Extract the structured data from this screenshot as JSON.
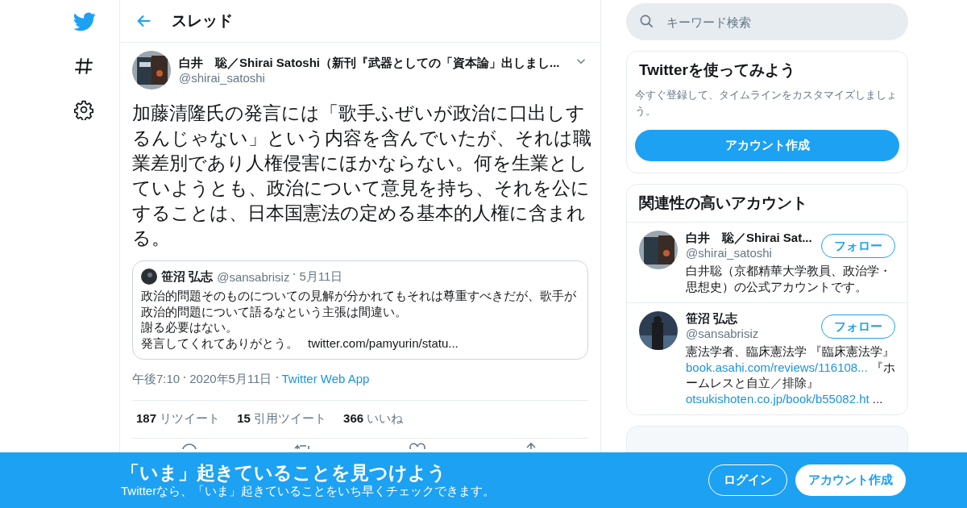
{
  "header": {
    "title": "スレッド"
  },
  "tweet": {
    "name": "白井　聡／Shirai Satoshi（新刊『武器としての「資本論」出しまし...",
    "handle": "@shirai_satoshi",
    "text": "加藤清隆氏の発言には「歌手ふぜいが政治に口出しするんじゃない」という内容を含んでいたが、それは職業差別であり人権侵害にほかならない。何を生業としていようとも、政治について意見を持ち、それを公にすることは、日本国憲法の定める基本的人権に含まれる。",
    "quote": {
      "name": "笹沼 弘志",
      "handle": "@sansabrisiz",
      "date": "5月11日",
      "lines": [
        "政治的問題そのものについての見解が分かれてもそれは尊重すべきだが、歌手が政治的問題について語るなという主張は間違い。",
        "謝る必要はない。"
      ],
      "last_line": "発言してくれてありがとう。",
      "link": "twitter.com/pamyurin/statu..."
    },
    "time": "午後7:10",
    "date": "2020年5月11日",
    "source": "Twitter Web App",
    "stats": [
      {
        "count": "187",
        "label": "リツイート"
      },
      {
        "count": "15",
        "label": "引用ツイート"
      },
      {
        "count": "366",
        "label": "いいね"
      }
    ]
  },
  "search": {
    "placeholder": "キーワード検索"
  },
  "signup": {
    "title": "Twitterを使ってみよう",
    "text": "今すぐ登録して、タイムラインをカスタマイズしましょう。",
    "button": "アカウント作成"
  },
  "related": {
    "title": "関連性の高いアカウント",
    "accounts": [
      {
        "name": "白井　聡／Shirai Sat...",
        "handle": "@shirai_satoshi",
        "follow": "フォロー",
        "bio": [
          {
            "kind": "text",
            "text": "白井聡（京都精華大学教員、政治学・思想史）の公式アカウントです。"
          }
        ]
      },
      {
        "name": "笹沼 弘志",
        "handle": "@sansabrisiz",
        "follow": "フォロー",
        "bio": [
          {
            "kind": "text",
            "text": "憲法学者、臨床憲法学 『臨床憲法学』"
          },
          {
            "kind": "link",
            "text": "book.asahi.com/reviews/116108..."
          },
          {
            "kind": "text",
            "text": " 『ホームレスと自立／排除』"
          },
          {
            "kind": "link",
            "text": "otsukishoten.co.jp/book/b55082.ht"
          },
          {
            "kind": "text",
            "text": " ..."
          }
        ]
      }
    ]
  },
  "banner": {
    "title": "「いま」起きていることを見つけよう",
    "subtitle": "Twitterなら、「いま」起きていることをいち早くチェックできます。",
    "login": "ログイン",
    "signup": "アカウント作成"
  }
}
